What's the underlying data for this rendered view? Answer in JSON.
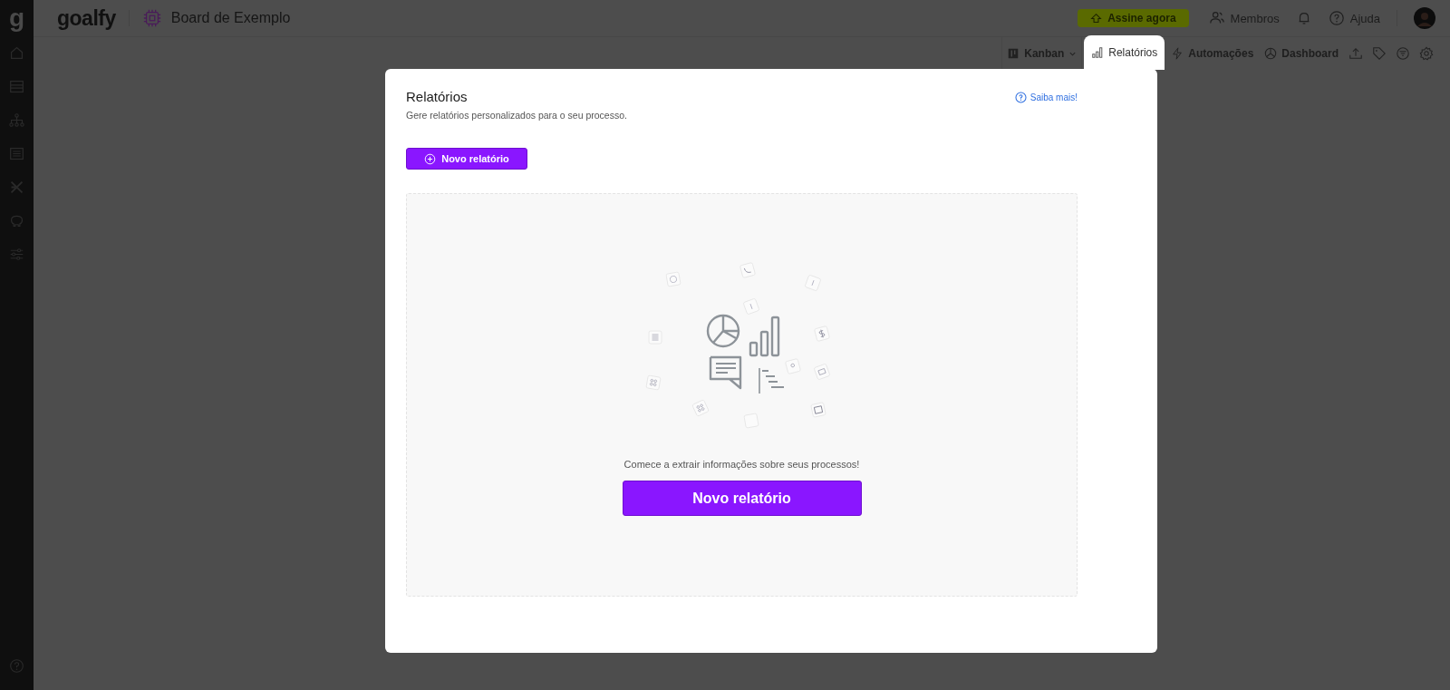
{
  "sidebar": {
    "logo": "g"
  },
  "header": {
    "brand": "goalfy",
    "board_title": "Board de Exemplo",
    "subscribe_button": "Assine agora",
    "members_button": "Membros",
    "help_button": "Ajuda"
  },
  "view_tabs": [
    {
      "kind": "dropdown",
      "label": "Kanban",
      "selected": false
    },
    {
      "kind": "tab",
      "label": "Relatórios",
      "selected": true
    },
    {
      "kind": "tab",
      "label": "Automações",
      "selected": false
    },
    {
      "kind": "tab",
      "label": "Dashboard",
      "selected": false
    }
  ],
  "dialog": {
    "title": "Relatórios",
    "subtitle": "Gere relatórios personalizados para o seu processo.",
    "help_link": "Saiba mais!",
    "new_button": "Novo relatório",
    "empty_state": {
      "message": "Comece a extrair informações sobre seus processos!",
      "button": "Novo relatório"
    }
  }
}
